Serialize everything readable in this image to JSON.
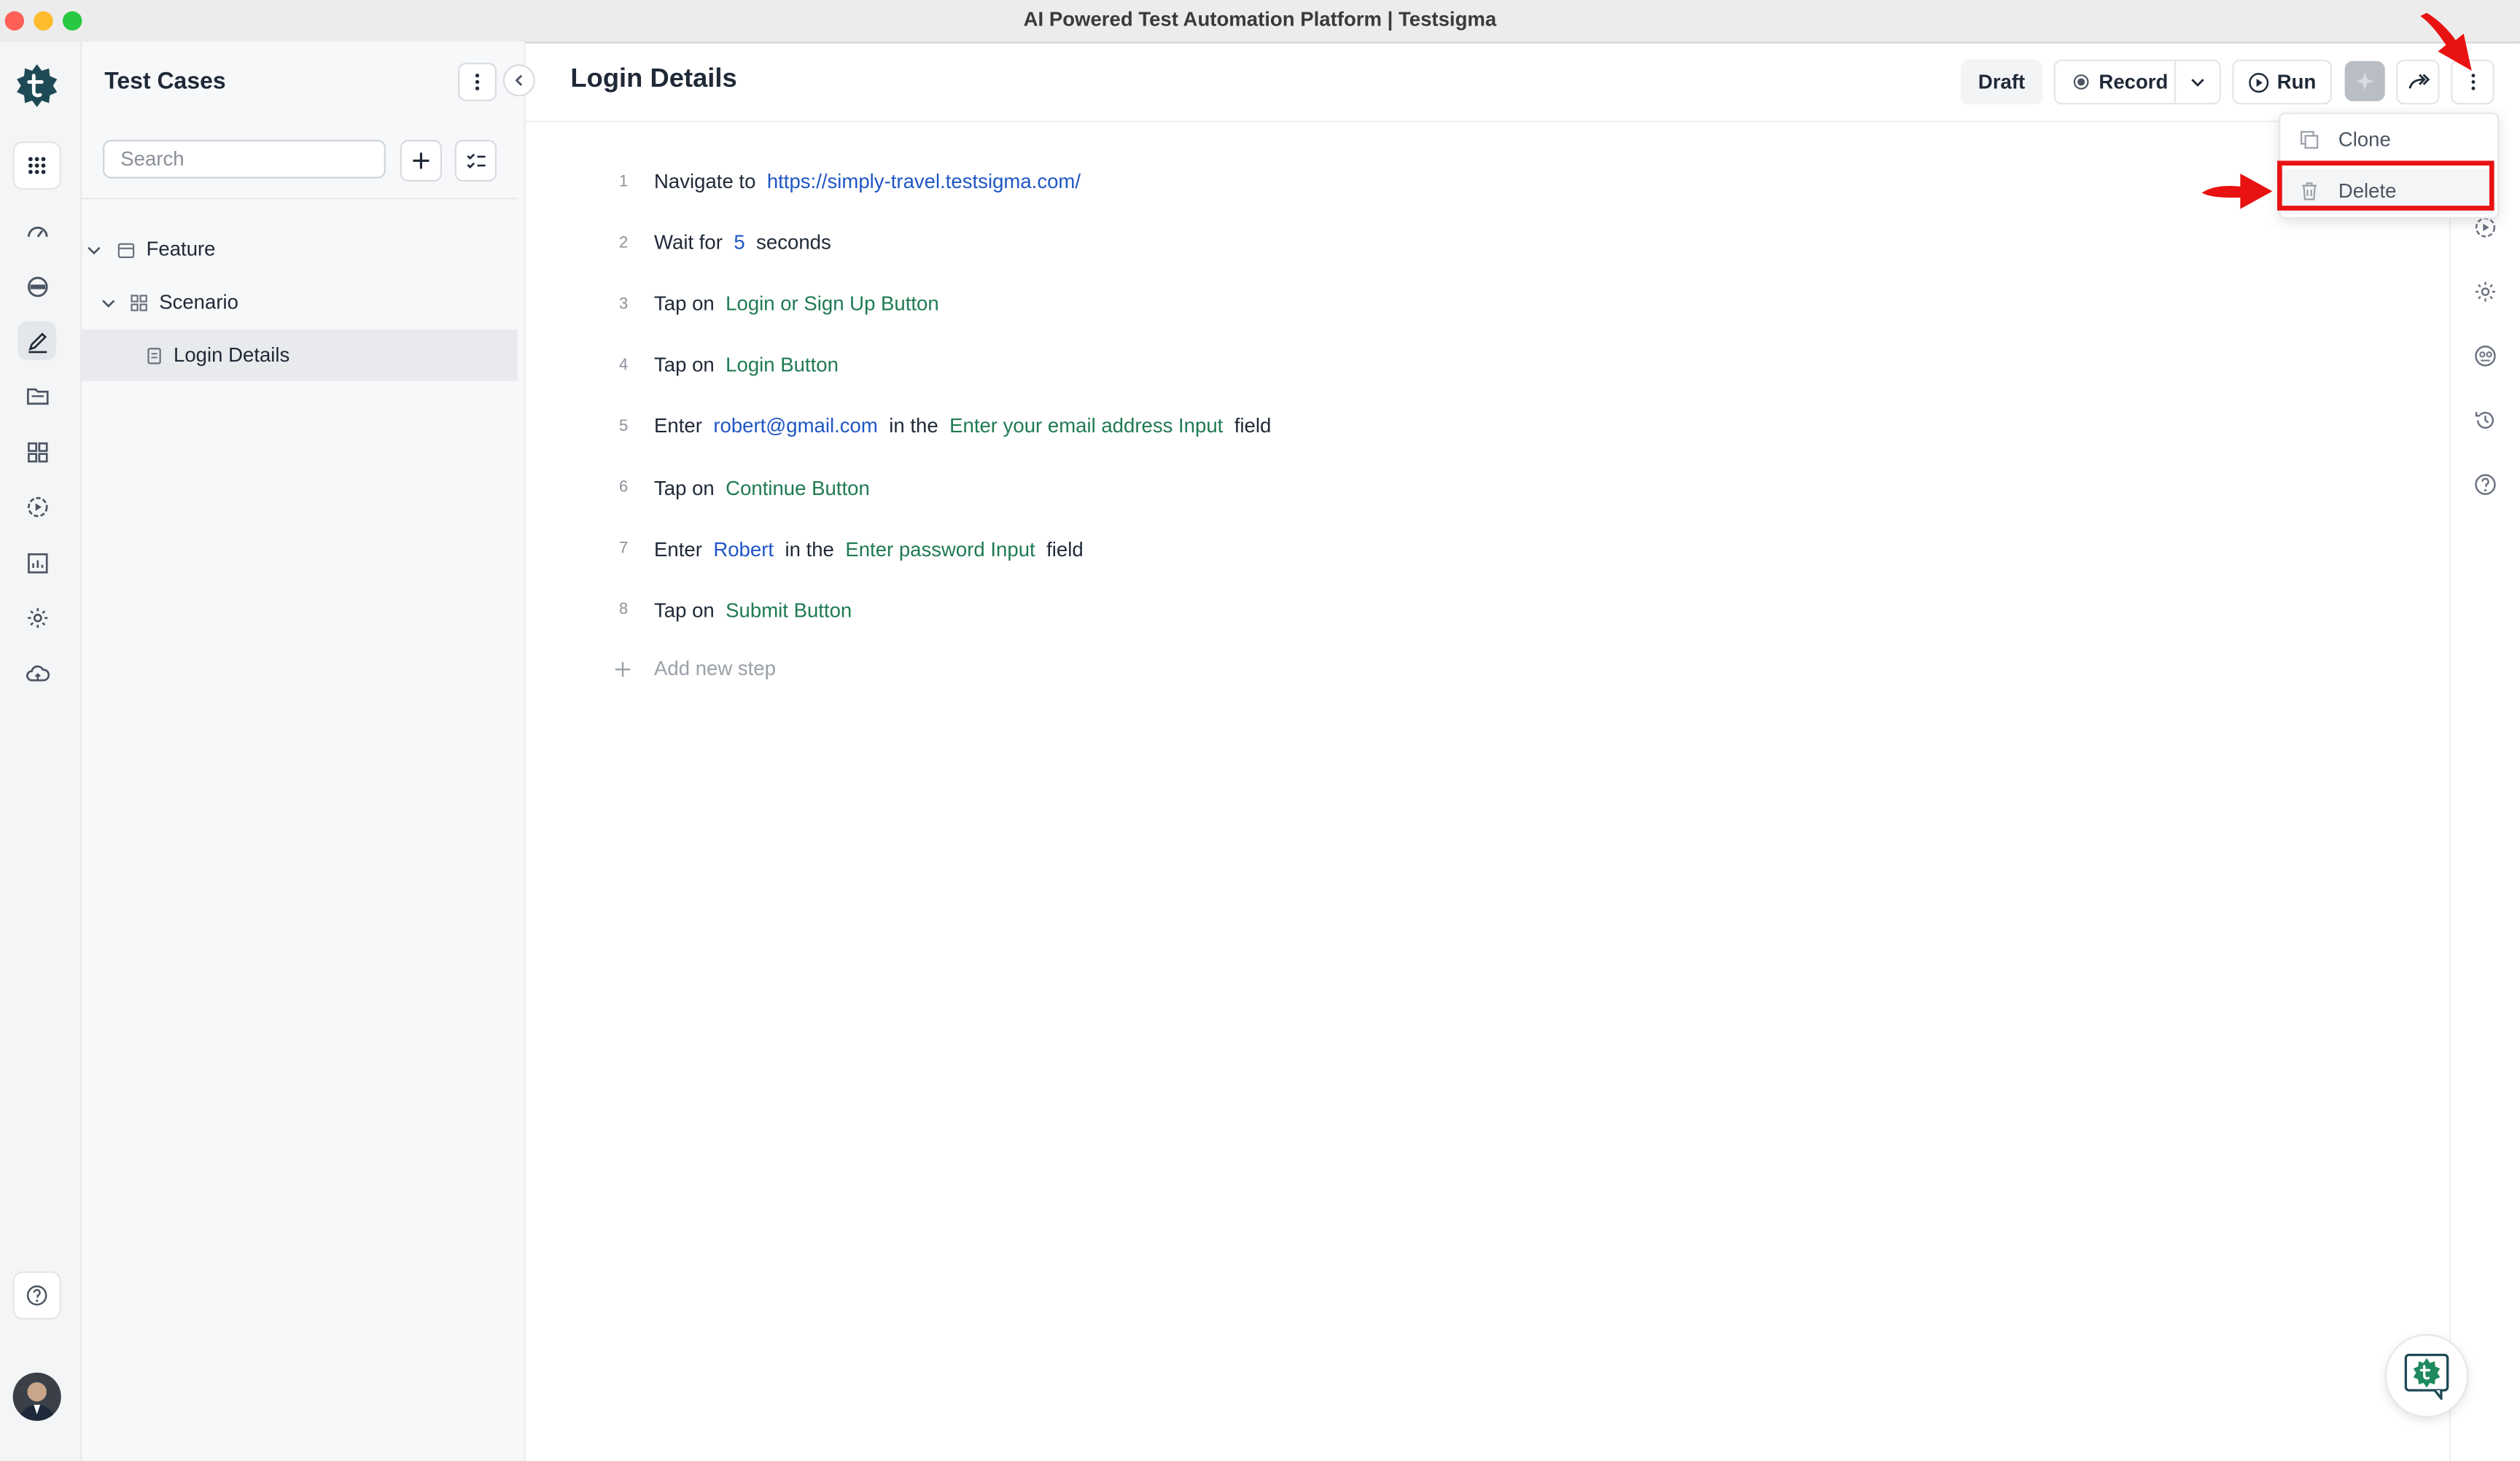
{
  "window": {
    "title": "AI Powered Test Automation Platform | Testsigma"
  },
  "rail": {
    "icons": [
      "logo-icon",
      "apps-grid-icon",
      "dashboard-icon",
      "review-icon",
      "edit-icon",
      "folder-icon",
      "modules-icon",
      "run-icon",
      "reports-icon",
      "settings-icon",
      "cloud-icon",
      "help-icon",
      "avatar"
    ]
  },
  "tree_panel": {
    "title": "Test Cases",
    "search_placeholder": "Search",
    "items": [
      {
        "label": "Feature",
        "level": 1,
        "expanded": true
      },
      {
        "label": "Scenario",
        "level": 2,
        "expanded": true
      },
      {
        "label": "Login Details",
        "level": 3,
        "selected": true
      }
    ]
  },
  "header": {
    "title": "Login Details",
    "status": "Draft",
    "record_label": "Record",
    "run_label": "Run"
  },
  "steps": [
    {
      "num": "1",
      "parts": [
        {
          "t": "txt",
          "v": "Navigate to"
        },
        {
          "t": "data",
          "v": "https://simply-travel.testsigma.com/"
        }
      ]
    },
    {
      "num": "2",
      "parts": [
        {
          "t": "txt",
          "v": "Wait for"
        },
        {
          "t": "data",
          "v": "5"
        },
        {
          "t": "txt",
          "v": "seconds"
        }
      ]
    },
    {
      "num": "3",
      "parts": [
        {
          "t": "txt",
          "v": "Tap on"
        },
        {
          "t": "elem",
          "v": "Login or Sign Up Button"
        }
      ]
    },
    {
      "num": "4",
      "parts": [
        {
          "t": "txt",
          "v": "Tap on"
        },
        {
          "t": "elem",
          "v": "Login Button"
        }
      ]
    },
    {
      "num": "5",
      "parts": [
        {
          "t": "txt",
          "v": "Enter"
        },
        {
          "t": "data",
          "v": "robert@gmail.com"
        },
        {
          "t": "txt",
          "v": "in the"
        },
        {
          "t": "elem",
          "v": "Enter your email address Input"
        },
        {
          "t": "txt",
          "v": "field"
        }
      ]
    },
    {
      "num": "6",
      "parts": [
        {
          "t": "txt",
          "v": "Tap on"
        },
        {
          "t": "elem",
          "v": "Continue Button"
        }
      ]
    },
    {
      "num": "7",
      "parts": [
        {
          "t": "txt",
          "v": "Enter"
        },
        {
          "t": "data",
          "v": "Robert"
        },
        {
          "t": "txt",
          "v": "in the"
        },
        {
          "t": "elem",
          "v": "Enter password Input"
        },
        {
          "t": "txt",
          "v": "field"
        }
      ]
    },
    {
      "num": "8",
      "parts": [
        {
          "t": "txt",
          "v": "Tap on"
        },
        {
          "t": "elem",
          "v": "Submit Button"
        }
      ]
    }
  ],
  "add_step_label": "Add new step",
  "dropdown": {
    "items": [
      {
        "label": "Clone",
        "icon": "copy-icon"
      },
      {
        "label": "Delete",
        "icon": "trash-icon",
        "highlighted": true
      }
    ]
  },
  "colors": {
    "brand": "#1d4a55",
    "data_link": "#1f56c4",
    "element_link": "#1f7a52",
    "annotation": "#e81212"
  }
}
